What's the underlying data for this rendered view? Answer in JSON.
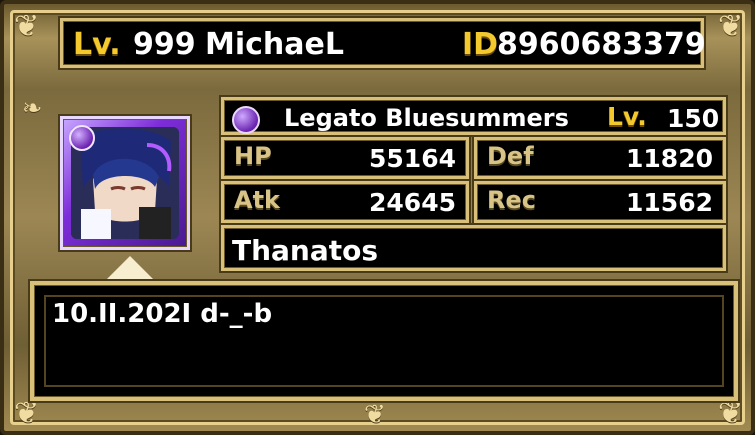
{
  "profile": {
    "lv_label": "Lv.",
    "lv_value": "999",
    "player_name": "MichaeL",
    "id_label": "ID",
    "id_value": "8960683379"
  },
  "unit": {
    "element_icon": "dark-orb-icon",
    "name": "Legato Bluesummers",
    "lv_label": "Lv.",
    "lv_value": "150",
    "portrait_icon": "character-portrait-icon"
  },
  "stats": {
    "hp_label": "HP",
    "hp_value": "55164",
    "def_label": "Def",
    "def_value": "11820",
    "atk_label": "Atk",
    "atk_value": "24645",
    "rec_label": "Rec",
    "rec_value": "11562"
  },
  "leader": {
    "text": "Thanatos"
  },
  "message": {
    "text": "10.II.202I d-_-b"
  },
  "colors": {
    "gold_text": "#f3c92d",
    "frame_gold": "#d9c07a",
    "panel_bg": "#000000",
    "dark_element": "#6a24b0"
  }
}
